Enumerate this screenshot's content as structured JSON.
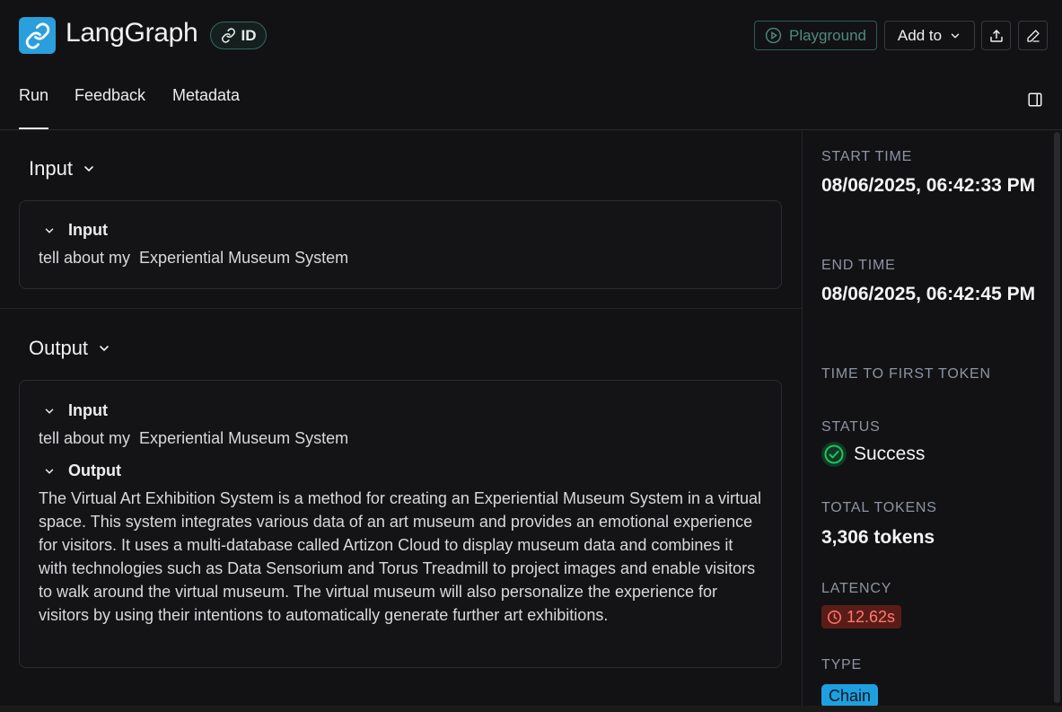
{
  "header": {
    "app_title": "LangGraph",
    "id_label": "ID",
    "playground_label": "Playground",
    "add_to_label": "Add to"
  },
  "tabs": [
    {
      "label": "Run"
    },
    {
      "label": "Feedback"
    },
    {
      "label": "Metadata"
    }
  ],
  "input_section": {
    "title": "Input",
    "card": {
      "heading": "Input",
      "text": "tell about my  Experiential Museum System"
    }
  },
  "output_section": {
    "title": "Output",
    "card": {
      "input_heading": "Input",
      "input_text": "tell about my  Experiential Museum System",
      "output_heading": "Output",
      "output_text": "The Virtual Art Exhibition System is a method for creating an Experiential Museum System in a virtual space. This system integrates various data of an art museum and provides an emotional experience for visitors. It uses a multi-database called Artizon Cloud to display museum data and combines it with technologies such as Data Sensorium and Torus Treadmill to project images and enable visitors to walk around the virtual museum. The virtual museum will also personalize the experience for visitors by using their intentions to automatically generate further art exhibitions."
    }
  },
  "sidebar": {
    "start_time_label": "START TIME",
    "start_time_value": "08/06/2025, 06:42:33 PM",
    "end_time_label": "END TIME",
    "end_time_value": "08/06/2025, 06:42:45 PM",
    "ttft_label": "TIME TO FIRST TOKEN",
    "status_label": "STATUS",
    "status_value": "Success",
    "total_tokens_label": "TOTAL TOKENS",
    "total_tokens_value": "3,306 tokens",
    "latency_label": "LATENCY",
    "latency_value": "12.62s",
    "type_label": "TYPE",
    "type_value": "Chain"
  },
  "colors": {
    "accent_blue": "#2a9fdc",
    "success_green": "#22c55e",
    "latency_red": "#ff7a6e",
    "playground_teal": "#4d8a7f"
  }
}
